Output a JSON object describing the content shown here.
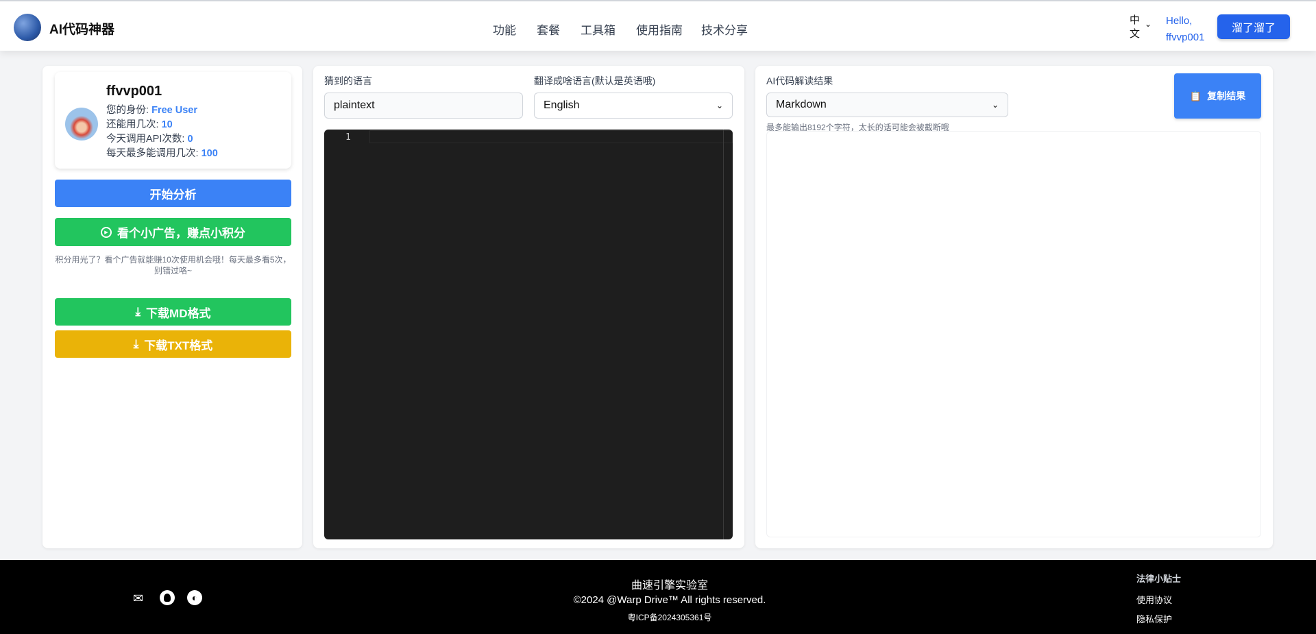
{
  "header": {
    "brand": "AI代码神器",
    "nav": [
      "功能",
      "套餐",
      "工具箱",
      "使用指南",
      "技术分享"
    ],
    "lang": "中文",
    "hello": "Hello,",
    "username": "ffvvp001",
    "action_button": "溜了溜了"
  },
  "profile": {
    "name": "ffvvp001",
    "identity_label": "您的身份: ",
    "identity": "Free User",
    "remaining_label": "还能用几次: ",
    "remaining": "10",
    "today_label": "今天调用API次数: ",
    "today": "0",
    "daily_max_label": "每天最多能调用几次: ",
    "daily_max": "100"
  },
  "actions": {
    "analyze": "开始分析",
    "watch_ad": "看个小广告，赚点小积分",
    "ad_note": "积分用光了？看个广告就能赚10次使用机会哦！每天最多看5次，别错过咯~",
    "download_md": "下载MD格式",
    "download_txt": "下载TXT格式"
  },
  "editor": {
    "detected_label": "猜到的语言",
    "detected_value": "plaintext",
    "translate_label": "翻译成啥语言(默认是英语哦)",
    "translate_value": "English",
    "line_numbers": [
      "1"
    ]
  },
  "result": {
    "label": "AI代码解读结果",
    "format_value": "Markdown",
    "hint": "最多能输出8192个字符，太长的话可能会被截断哦",
    "copy_button": "复制结果"
  },
  "footer": {
    "org": "曲速引擎实验室",
    "copyright": "©2024 @Warp Drive™ All rights reserved.",
    "icp": "粤ICP备2024305361号",
    "legal_title": "法律小贴士",
    "terms": "使用协议",
    "privacy": "隐私保护",
    "icons": [
      "mail-icon",
      "github-icon",
      "globe-icon"
    ]
  },
  "colors": {
    "primary": "#3b82f6",
    "green": "#22c55e",
    "yellow": "#eab308",
    "editor_bg": "#1e1e1e"
  }
}
